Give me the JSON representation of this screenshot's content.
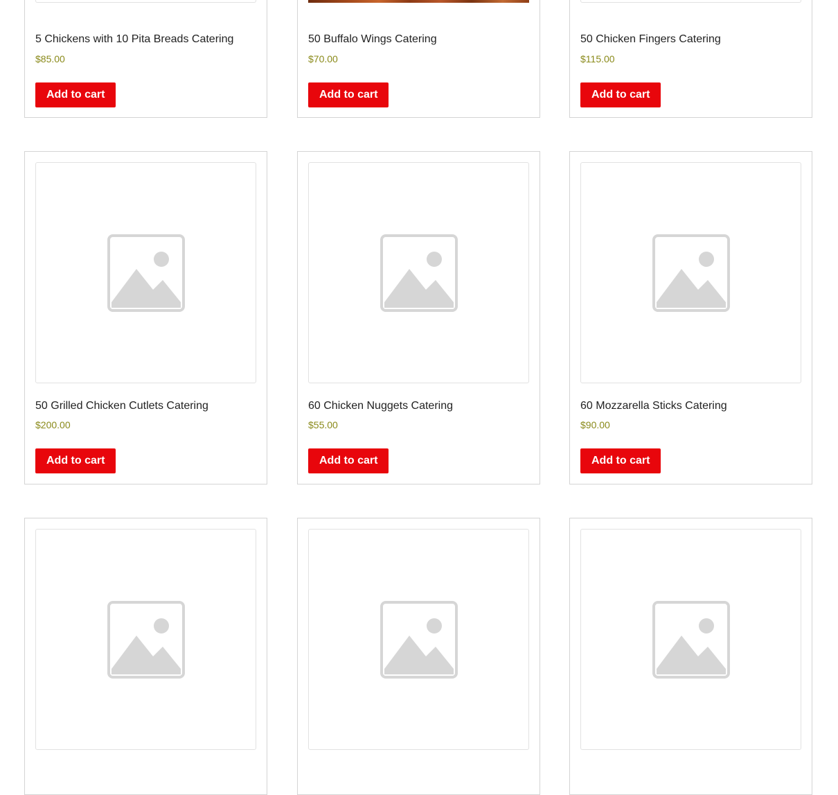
{
  "products": [
    {
      "title": "5 Chickens with 10 Pita Breads Catering",
      "price": "$85.00",
      "button_label": "Add to cart",
      "image": "placeholder-image-icon"
    },
    {
      "title": "50 Buffalo Wings Catering",
      "price": "$70.00",
      "button_label": "Add to cart",
      "image": "product-photo"
    },
    {
      "title": "50 Chicken Fingers Catering",
      "price": "$115.00",
      "button_label": "Add to cart",
      "image": "placeholder-image-icon"
    },
    {
      "title": "50 Grilled Chicken Cutlets Catering",
      "price": "$200.00",
      "button_label": "Add to cart",
      "image": "placeholder-image-icon"
    },
    {
      "title": "60 Chicken Nuggets Catering",
      "price": "$55.00",
      "button_label": "Add to cart",
      "image": "placeholder-image-icon"
    },
    {
      "title": "60 Mozzarella Sticks Catering",
      "price": "$90.00",
      "button_label": "Add to cart",
      "image": "placeholder-image-icon"
    },
    {
      "image": "placeholder-image-icon"
    },
    {
      "image": "placeholder-image-icon"
    },
    {
      "image": "placeholder-image-icon"
    }
  ],
  "colors": {
    "button_bg": "#e8060c",
    "button_text": "#ffffff",
    "price": "#8a8a1a",
    "title": "#222222",
    "card_border": "#d4d4d4",
    "placeholder_icon": "#d6d6d6"
  }
}
